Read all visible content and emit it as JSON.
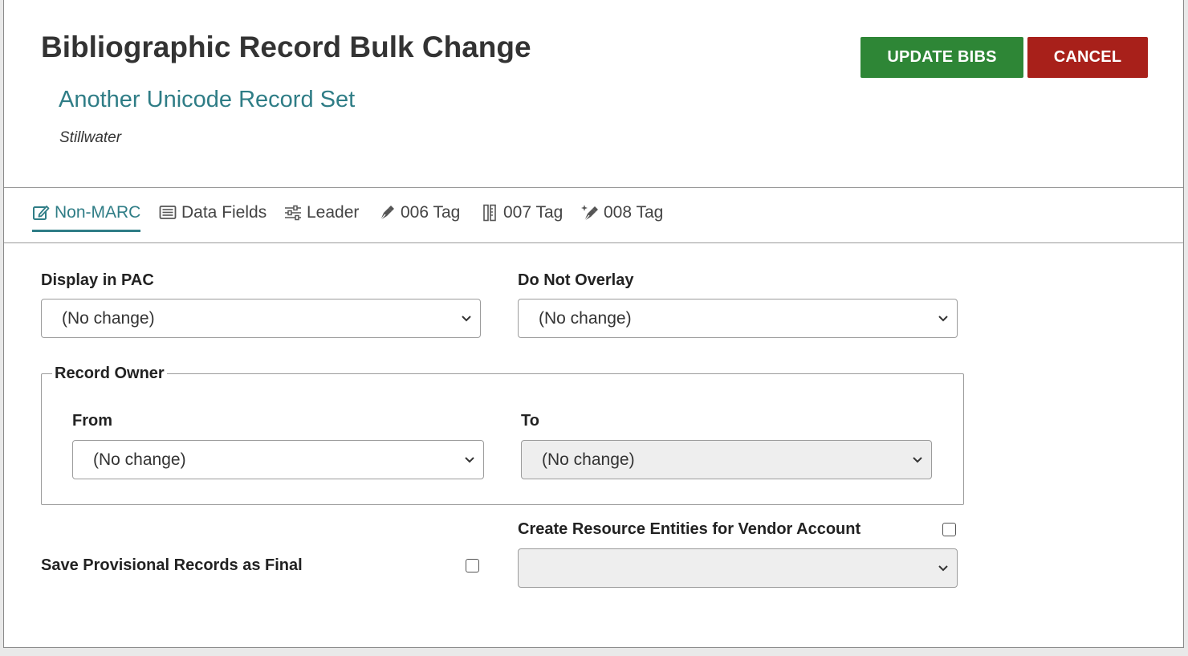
{
  "header": {
    "title": "Bibliographic Record Bulk Change",
    "record_set": "Another Unicode Record Set",
    "location": "Stillwater",
    "update_label": "UPDATE BIBS",
    "cancel_label": "CANCEL"
  },
  "tabs": [
    {
      "label": "Non-MARC",
      "icon": "edit-icon",
      "active": true
    },
    {
      "label": "Data Fields",
      "icon": "list-icon",
      "active": false
    },
    {
      "label": "Leader",
      "icon": "sliders-icon",
      "active": false
    },
    {
      "label": "006 Tag",
      "icon": "pen-icon",
      "active": false
    },
    {
      "label": "007 Tag",
      "icon": "ruler-icon",
      "active": false
    },
    {
      "label": "008 Tag",
      "icon": "pen-sparkle-icon",
      "active": false
    }
  ],
  "form": {
    "display_in_pac": {
      "label": "Display in PAC",
      "value": "(No change)"
    },
    "do_not_overlay": {
      "label": "Do Not Overlay",
      "value": "(No change)"
    },
    "record_owner": {
      "legend": "Record Owner",
      "from": {
        "label": "From",
        "value": "(No change)"
      },
      "to": {
        "label": "To",
        "value": "(No change)"
      }
    },
    "save_provisional": {
      "label": "Save Provisional Records as Final",
      "checked": false
    },
    "create_resource_entities": {
      "label": "Create Resource Entities for Vendor Account",
      "checked": false,
      "value": ""
    }
  },
  "colors": {
    "accent": "#2f7d86",
    "update": "#2e8636",
    "cancel": "#a8201a"
  }
}
